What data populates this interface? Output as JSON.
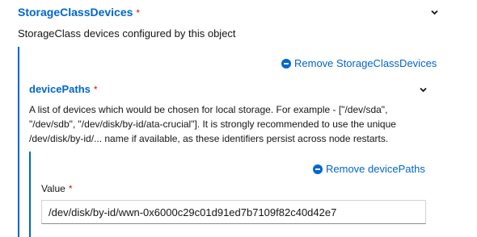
{
  "storage_class_devices": {
    "title": "StorageClassDevices",
    "required_mark": "*",
    "description": "StorageClass devices configured by this object",
    "remove_label": "Remove StorageClassDevices"
  },
  "device_paths": {
    "title": "devicePaths",
    "required_mark": "*",
    "description_lines": [
      "A list of devices which would be chosen for local storage. For example - [\"/dev/sda\",",
      "\"/dev/sdb\", \"/dev/disk/by-id/ata-crucial\"]. It is strongly recommended to use the unique",
      "/dev/disk/by-id/... name if available, as these identifiers persist across node restarts."
    ],
    "remove_label": "Remove devicePaths",
    "value_label": "Value",
    "value_required_mark": "*",
    "value": "/dev/disk/by-id/wwn-0x6000c29c01d91ed7b7109f82c40d42e7"
  },
  "colors": {
    "accent": "#0066cc",
    "required": "#c9190b"
  },
  "icons": [
    "chevron-down-icon",
    "minus-circle-icon"
  ]
}
